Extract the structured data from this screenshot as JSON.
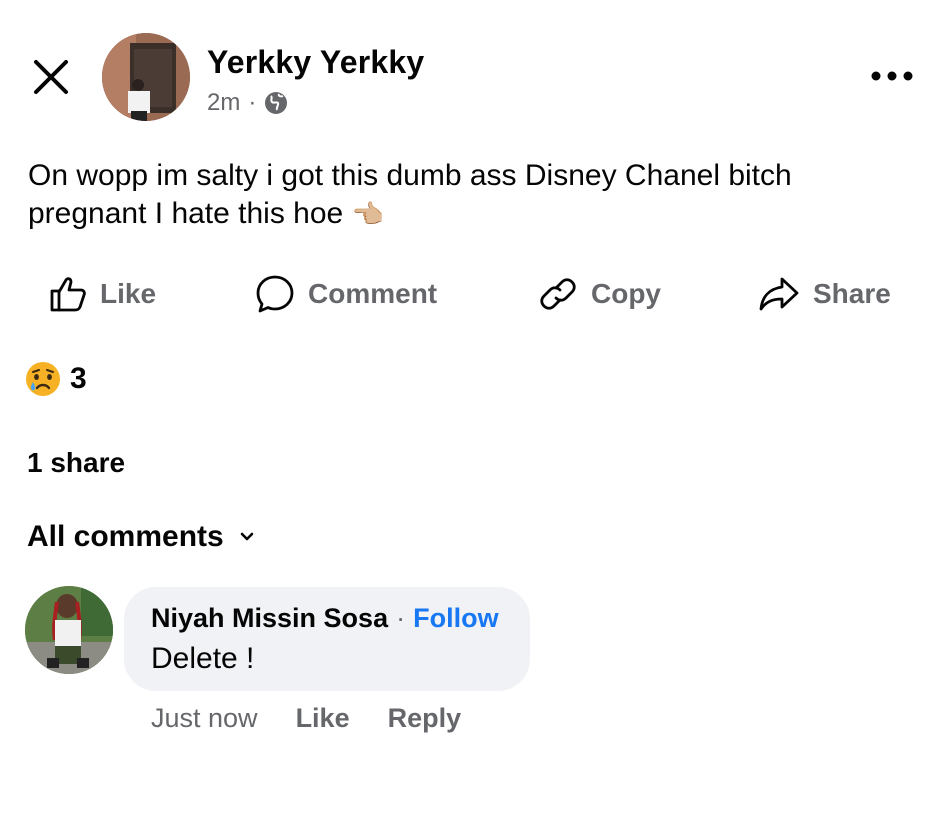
{
  "post": {
    "author": "Yerkky Yerkky",
    "time": "2m",
    "separator": "·",
    "text_line1": "On wopp im salty i got this dumb ass Disney Chanel bitch",
    "text_line2": "pregnant I hate this hoe",
    "text_emoji": "👈🏼"
  },
  "actions": {
    "like": "Like",
    "comment": "Comment",
    "copy": "Copy",
    "share": "Share"
  },
  "reactions": {
    "emoji": "😢",
    "count": "3"
  },
  "shares": "1 share",
  "comments_filter": "All comments",
  "comment": {
    "author": "Niyah Missin Sosa",
    "separator": "·",
    "follow": "Follow",
    "text": "Delete !",
    "time": "Just now",
    "like": "Like",
    "reply": "Reply"
  },
  "colors": {
    "follow": "#1877f2",
    "secondary": "#65676b",
    "bubble": "#f0f2f5"
  },
  "icons": [
    "close-icon",
    "globe-icon",
    "more-icon",
    "like-icon",
    "comment-icon",
    "copy-link-icon",
    "share-icon",
    "chevron-down-icon"
  ]
}
